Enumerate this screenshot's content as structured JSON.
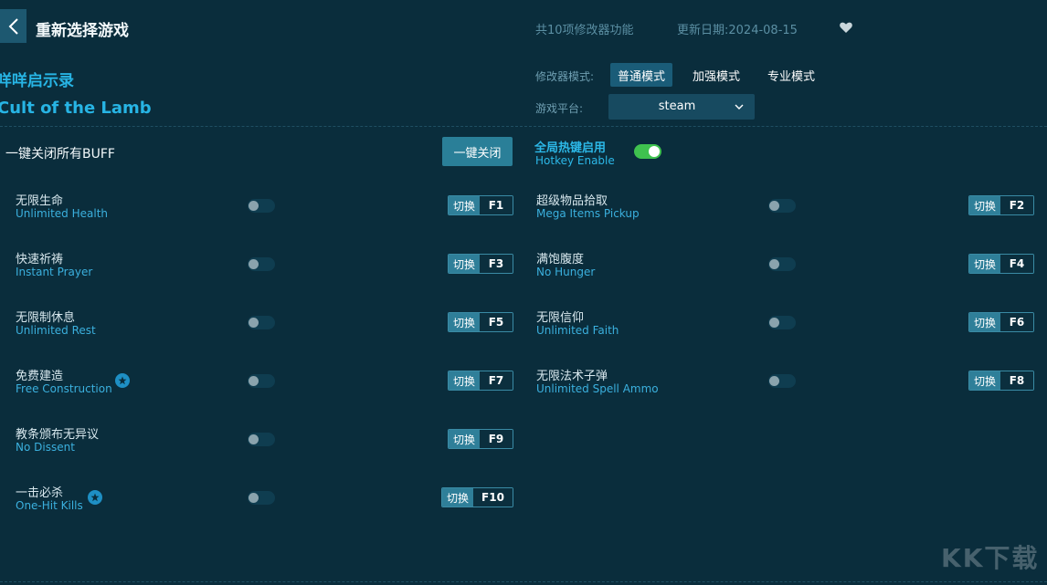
{
  "header": {
    "title": "重新选择游戏",
    "feature_count": "共10项修改器功能",
    "update_date": "更新日期:2024-08-15"
  },
  "game": {
    "name_cn": "咩咩启示录",
    "name_en": "Cult of the Lamb"
  },
  "mode": {
    "label": "修改器模式:",
    "options": [
      "普通模式",
      "加强模式",
      "专业模式"
    ],
    "selected": "普通模式"
  },
  "platform": {
    "label": "游戏平台:",
    "value": "steam"
  },
  "close_all": {
    "label": "一键关闭所有BUFF",
    "button": "一键关闭"
  },
  "hotkey": {
    "label_cn": "全局热键启用",
    "label_en": "Hotkey Enable",
    "enabled": true
  },
  "switch_label": "切换",
  "cheats": [
    {
      "cn": "无限生命",
      "en": "Unlimited Health",
      "key": "F1",
      "on": false,
      "star": false
    },
    {
      "cn": "超级物品拾取",
      "en": "Mega Items Pickup",
      "key": "F2",
      "on": false,
      "star": false
    },
    {
      "cn": "快速祈祷",
      "en": "Instant Prayer",
      "key": "F3",
      "on": false,
      "star": false
    },
    {
      "cn": "满饱腹度",
      "en": "No Hunger",
      "key": "F4",
      "on": false,
      "star": false
    },
    {
      "cn": "无限制休息",
      "en": "Unlimited Rest",
      "key": "F5",
      "on": false,
      "star": false
    },
    {
      "cn": "无限信仰",
      "en": "Unlimited Faith",
      "key": "F6",
      "on": false,
      "star": false
    },
    {
      "cn": "免费建造",
      "en": "Free Construction",
      "key": "F7",
      "on": false,
      "star": true
    },
    {
      "cn": "无限法术子弹",
      "en": "Unlimited Spell Ammo",
      "key": "F8",
      "on": false,
      "star": false
    },
    {
      "cn": "教条颁布无异议",
      "en": "No Dissent",
      "key": "F9",
      "on": false,
      "star": false
    },
    {
      "cn": "一击必杀",
      "en": "One-Hit Kills",
      "key": "F10",
      "on": false,
      "star": true
    }
  ],
  "watermark": "KK下载",
  "colors": {
    "background": "#0a2d3c",
    "accent": "#27b4e4",
    "toggle_on": "#3fc24f"
  }
}
